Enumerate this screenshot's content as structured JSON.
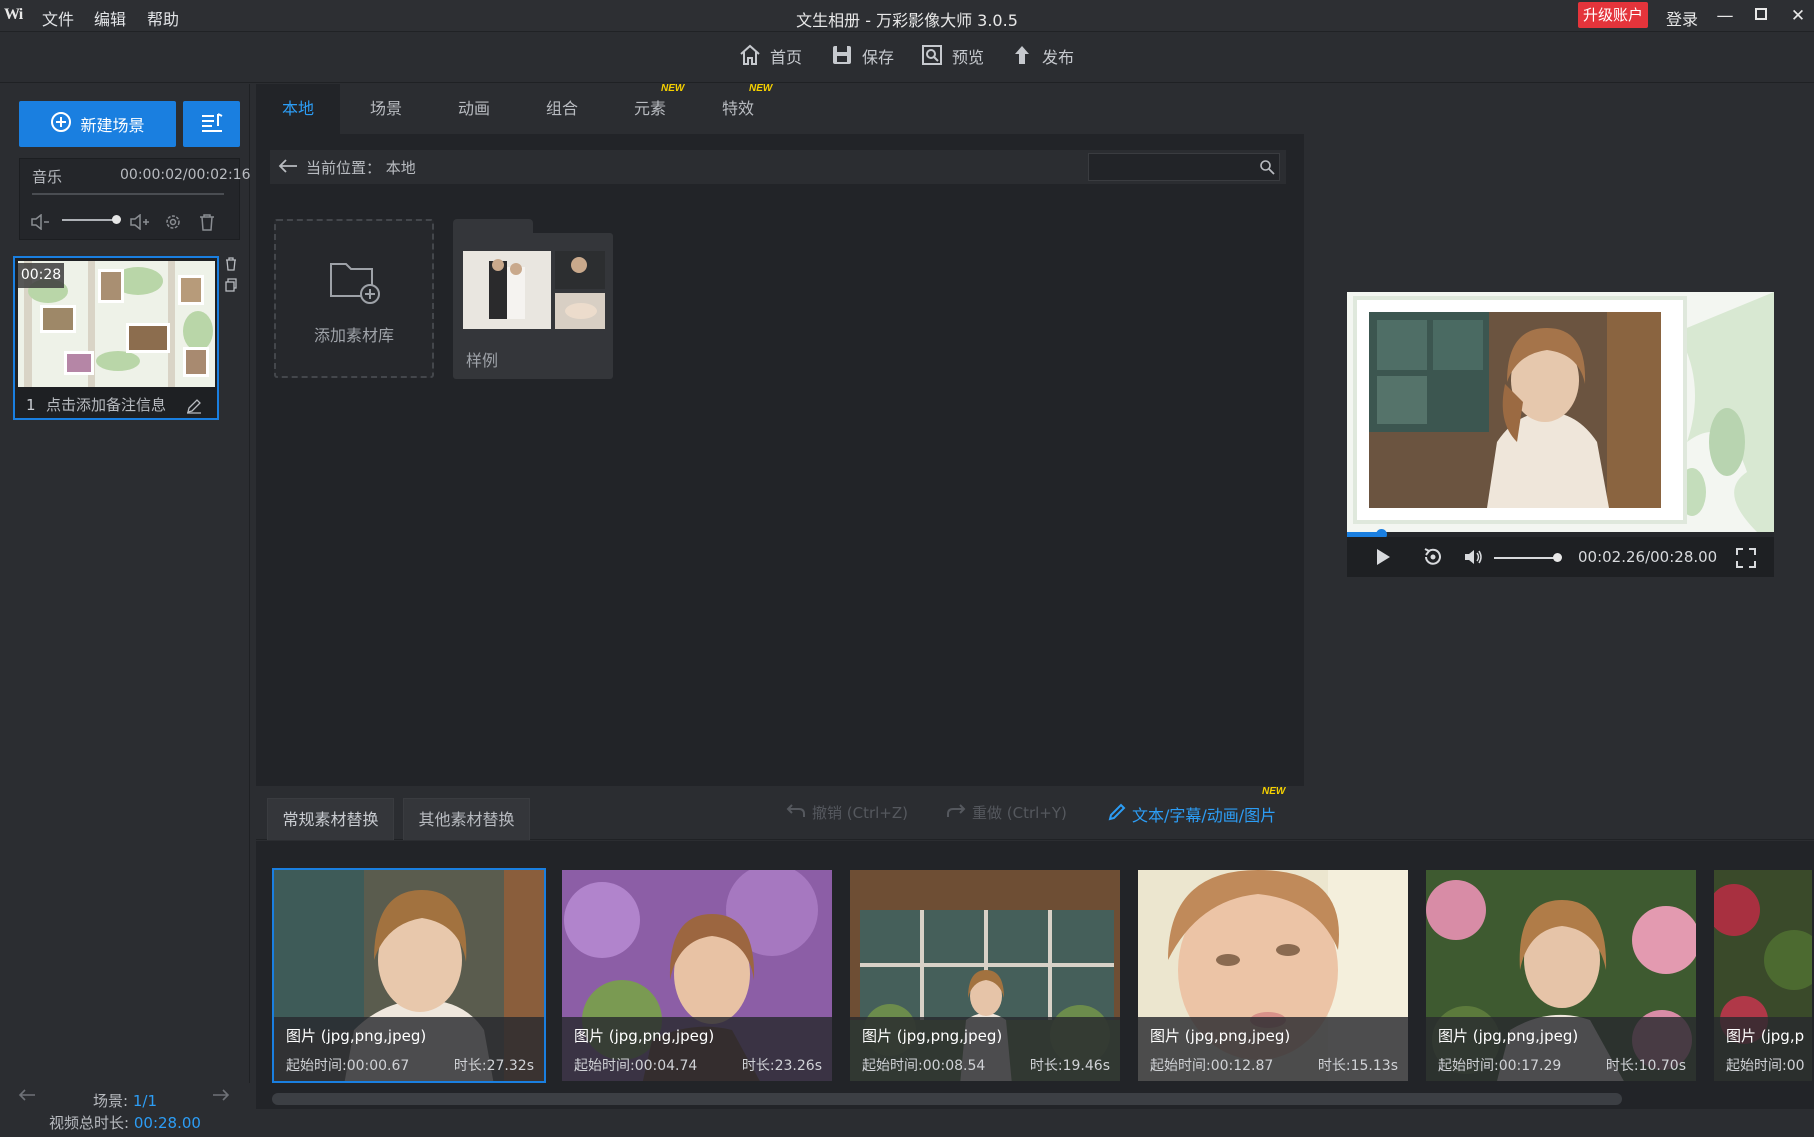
{
  "titlebar": {
    "logo": "Wi",
    "menu": [
      "文件",
      "编辑",
      "帮助"
    ],
    "title": "文生相册 - 万彩影像大师 3.0.5",
    "upgrade": "升级账户",
    "login": "登录"
  },
  "toolbar": {
    "home": "首页",
    "save": "保存",
    "preview": "预览",
    "publish": "发布"
  },
  "left": {
    "new_scene": "新建场景",
    "music_label": "音乐",
    "music_time": "00:00:02/00:02:16",
    "scene_time": "00:28",
    "scene_index": "1",
    "scene_note": "点击添加备注信息",
    "scene_count_label": "场景:",
    "scene_count_value": "1/1",
    "total_label": "视频总时长:",
    "total_value": "00:28.00"
  },
  "tabs": [
    {
      "label": "本地",
      "active": true
    },
    {
      "label": "场景"
    },
    {
      "label": "动画"
    },
    {
      "label": "组合"
    },
    {
      "label": "元素",
      "badge": "NEW"
    },
    {
      "label": "特效",
      "badge": "NEW"
    }
  ],
  "path": {
    "label": "当前位置：",
    "value": "本地"
  },
  "library": {
    "add_label": "添加素材库",
    "folder_label": "样例"
  },
  "player": {
    "time": "00:02.26/00:28.00",
    "progress": 0.08
  },
  "bottom": {
    "tab1": "常规素材替换",
    "tab2": "其他素材替换",
    "undo": "撤销 (Ctrl+Z)",
    "redo": "重做 (Ctrl+Y)",
    "text_link": "文本/字幕/动画/图片",
    "text_badge": "NEW"
  },
  "items": [
    {
      "type": "图片 (jpg,png,jpeg)",
      "start": "起始时间:00:00.67",
      "dur": "时长:27.32s"
    },
    {
      "type": "图片 (jpg,png,jpeg)",
      "start": "起始时间:00:04.74",
      "dur": "时长:23.26s"
    },
    {
      "type": "图片 (jpg,png,jpeg)",
      "start": "起始时间:00:08.54",
      "dur": "时长:19.46s"
    },
    {
      "type": "图片 (jpg,png,jpeg)",
      "start": "起始时间:00:12.87",
      "dur": "时长:15.13s"
    },
    {
      "type": "图片 (jpg,png,jpeg)",
      "start": "起始时间:00:17.29",
      "dur": "时长:10.70s"
    },
    {
      "type": "图片 (jpg,p",
      "start": "起始时间:00",
      "dur": ""
    }
  ],
  "colors": {
    "accent": "#1a7fe0",
    "link": "#2c9df5",
    "upgrade": "#e4343b",
    "badge": "#f5d000"
  }
}
